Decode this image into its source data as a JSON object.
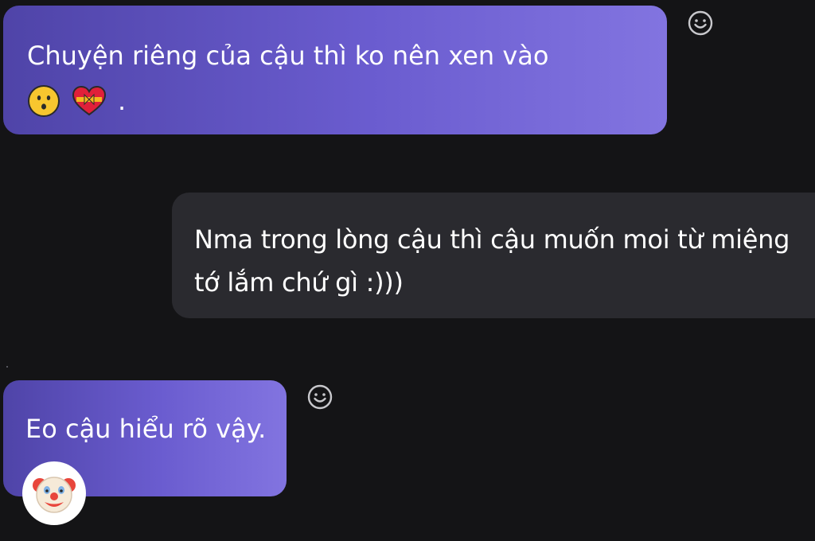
{
  "messages": [
    {
      "id": "msg1",
      "direction": "outgoing",
      "text": "Chuyện riêng của cậu thì ko nên xen vào",
      "emojis": [
        "hushed-face-emoji",
        "heart-with-ribbon-emoji"
      ],
      "trailing": "."
    },
    {
      "id": "msg2",
      "direction": "incoming",
      "line1": "Nma trong lòng cậu thì cậu muốn moi từ miệng",
      "line2": "tớ lắm chứ gì :)))"
    },
    {
      "id": "msg3",
      "direction": "outgoing",
      "text": "Eo cậu hiểu rõ vậy.",
      "reaction": "clown-face-emoji"
    }
  ],
  "icons": {
    "react": "smiley-react-icon"
  },
  "colors": {
    "background": "#141416",
    "outgoing_start": "#4f44a8",
    "outgoing_end": "#8274e0",
    "incoming": "#2a2a2f",
    "text": "#ffffff"
  }
}
